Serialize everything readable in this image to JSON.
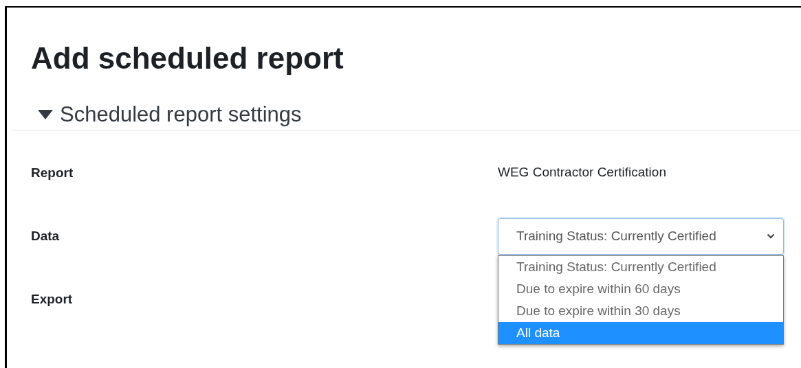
{
  "page": {
    "title": "Add scheduled report"
  },
  "section": {
    "title": "Scheduled report settings",
    "expanded": true
  },
  "fields": [
    {
      "label": "Report",
      "kind": "text",
      "value": "WEG Contractor Certification"
    },
    {
      "label": "Data",
      "kind": "select",
      "value": "Training Status: Currently Certified",
      "expanded": true,
      "options": [
        {
          "label": "Training Status: Currently Certified",
          "highlighted": false
        },
        {
          "label": "Due to expire within 60 days",
          "highlighted": false
        },
        {
          "label": "Due to expire within 30 days",
          "highlighted": false
        },
        {
          "label": "All data",
          "highlighted": true
        }
      ]
    },
    {
      "label": "Export",
      "kind": "label"
    }
  ]
}
